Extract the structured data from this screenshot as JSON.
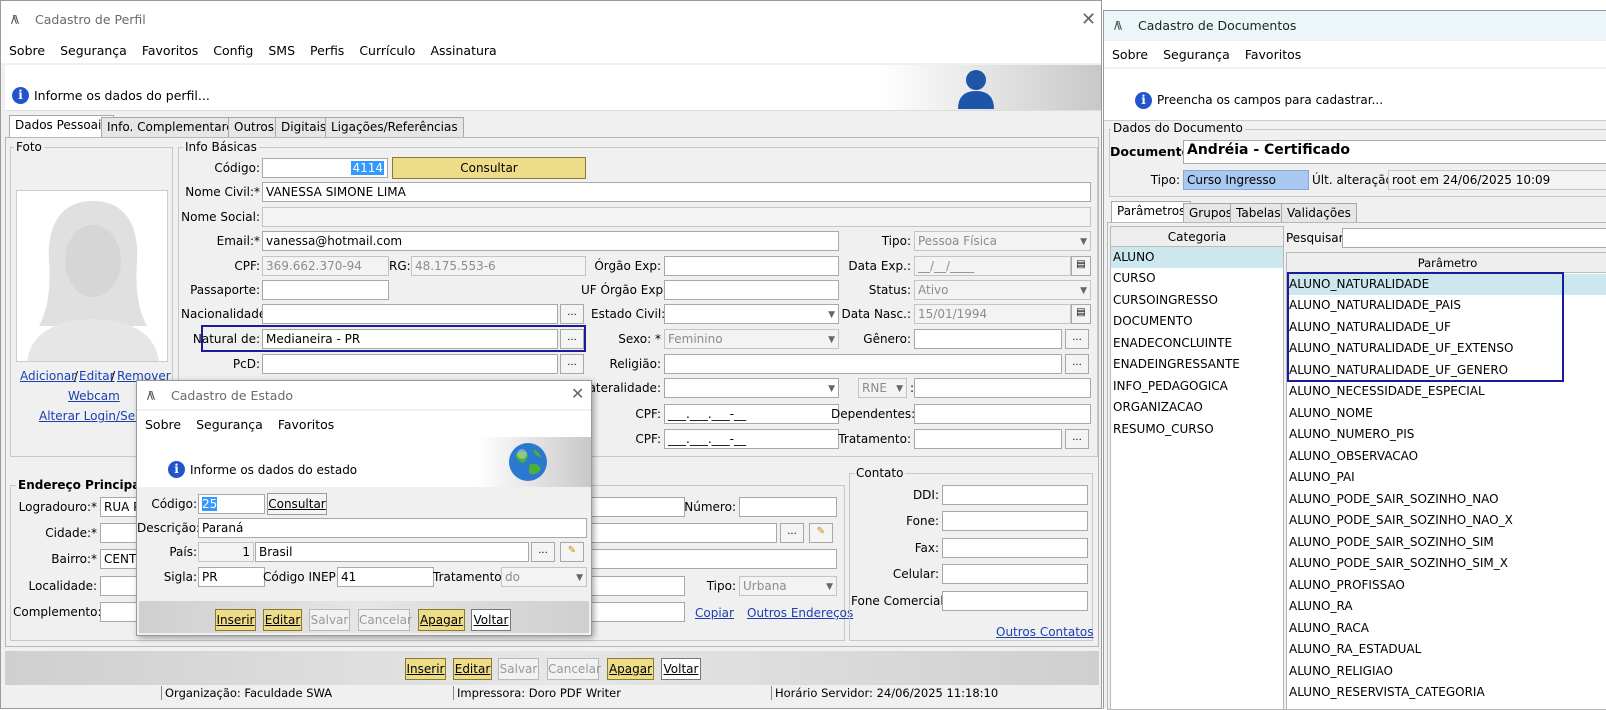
{
  "perfil": {
    "title": "Cadastro de Perfil",
    "menu": [
      "Sobre",
      "Segurança",
      "Favoritos",
      "Config",
      "SMS",
      "Perfis",
      "Currículo",
      "Assinatura"
    ],
    "info_msg": "Informe os dados do perfil...",
    "tabs": [
      "Dados Pessoais",
      "Info. Complementares",
      "Outros",
      "Digitais",
      "Ligações/Referências"
    ],
    "foto": {
      "title": "Foto",
      "adicionar": "Adicionar",
      "sep1": "/",
      "editar": "Editar",
      "sep2": "/",
      "remover": "Remover",
      "webcam": "Webcam",
      "alterar": "Alterar Login/Senha"
    },
    "info_basicas": {
      "title": "Info Básicas",
      "codigo_label": "Código:",
      "codigo": "4114",
      "consultar": "Consultar",
      "nome_civil_label": "Nome Civil:*",
      "nome_civil": "VANESSA SIMONE LIMA",
      "nome_social_label": "Nome Social:",
      "nome_social": "",
      "email_label": "Email:*",
      "email": "vanessa@hotmail.com",
      "tipo_label": "Tipo:",
      "tipo": "Pessoa Física",
      "cpf_label": "CPF:",
      "cpf": "369.662.370-94",
      "rg_label": "RG:",
      "rg": "48.175.553-6",
      "orgao_label": "Órgão Exp:",
      "orgao": "",
      "data_exp_label": "Data Exp.:",
      "data_exp": "__/__/____",
      "passaporte_label": "Passaporte:",
      "uf_orgao_label": "UF Órgão Exp:",
      "status_label": "Status:",
      "status": "Ativo",
      "nacionalidade_label": "Nacionalidade:",
      "estado_civil_label": "Estado Civil:",
      "data_nasc_label": "Data Nasc.:",
      "data_nasc": "15/01/1994",
      "natural_label": "Natural de:",
      "natural": "Medianeira - PR",
      "sexo_label": "Sexo: *",
      "sexo": "Feminino",
      "genero_label": "Gênero:",
      "pcd_label": "PcD:",
      "religiao_label": "Religião:",
      "lateralidade_label": "Lateralidade:",
      "rne": "RNE",
      "cpf2_label": "CPF:",
      "cpf2": "___.___.___-__",
      "dependentes_label": "Dependentes:",
      "cpf3_label": "CPF:",
      "cpf3": "___.___.___-__",
      "tratamento_label": "Tratamento:",
      "ellipsis": "..."
    },
    "endereco": {
      "title": "Endereço Principal",
      "logradouro_label": "Logradouro:*",
      "logradouro": "RUA PA",
      "numero_label": "Número:",
      "cidade_label": "Cidade:*",
      "bairro_label": "Bairro:*",
      "bairro": "CENTR",
      "localidade_label": "Localidade:",
      "tipo_label": "Tipo:",
      "tipo": "Urbana",
      "complemento_label": "Complemento:",
      "copiar": "Copiar",
      "outros": "Outros Endereços"
    },
    "contato": {
      "title": "Contato",
      "ddi": "DDI:",
      "fone": "Fone:",
      "fax": "Fax:",
      "celular": "Celular:",
      "fone_com": "Fone Comercial:",
      "outros": "Outros Contatos"
    },
    "buttons": {
      "inserir": "Inserir",
      "editar": "Editar",
      "salvar": "Salvar",
      "cancelar": "Cancelar",
      "apagar": "Apagar",
      "voltar": "Voltar"
    },
    "status_bar": {
      "org": "Organização: Faculdade SWA",
      "printer": "Impressora: Doro PDF Writer",
      "hora": "Horário Servidor: 24/06/2025 11:18:10"
    }
  },
  "estado": {
    "title": "Cadastro de Estado",
    "menu": [
      "Sobre",
      "Segurança",
      "Favoritos"
    ],
    "info_msg": "Informe os dados do estado",
    "codigo_label": "Código:",
    "codigo": "25",
    "consultar": "Consultar",
    "descricao_label": "Descrição:",
    "descricao": "Paraná",
    "pais_label": "País:",
    "pais_cod": "1",
    "pais": "Brasil",
    "sigla_label": "Sigla:",
    "sigla": "PR",
    "inep_label": "Código INEP:",
    "inep": "41",
    "tratamento_label": "Tratamento:",
    "tratamento": "do",
    "buttons": {
      "inserir": "Inserir",
      "editar": "Editar",
      "salvar": "Salvar",
      "cancelar": "Cancelar",
      "apagar": "Apagar",
      "voltar": "Voltar"
    }
  },
  "documentos": {
    "title": "Cadastro de Documentos",
    "menu": [
      "Sobre",
      "Segurança",
      "Favoritos"
    ],
    "info_msg": "Preencha os campos para cadastrar...",
    "group_title": "Dados do Documento",
    "documento_label": "Documento:",
    "documento": "Andréia - Certificado",
    "tipo_label": "Tipo:",
    "tipo": "Curso Ingresso",
    "ult_label": "Últ. alteração:",
    "ult": "root em 24/06/2025 10:09",
    "tabs": [
      "Parâmetros",
      "Grupos",
      "Tabelas",
      "Validações"
    ],
    "categoria_header": "Categoria",
    "categorias": [
      "ALUNO",
      "CURSO",
      "CURSOINGRESSO",
      "DOCUMENTO",
      "ENADECONCLUINTE",
      "ENADEINGRESSANTE",
      "INFO_PEDAGOGICA",
      "ORGANIZACAO",
      "RESUMO_CURSO"
    ],
    "pesquisar_label": "Pesquisar:",
    "parametro_header": "Parâmetro",
    "parametros": [
      "ALUNO_NATURALIDADE",
      "ALUNO_NATURALIDADE_PAIS",
      "ALUNO_NATURALIDADE_UF",
      "ALUNO_NATURALIDADE_UF_EXTENSO",
      "ALUNO_NATURALIDADE_UF_GENERO",
      "ALUNO_NECESSIDADE_ESPECIAL",
      "ALUNO_NOME",
      "ALUNO_NUMERO_PIS",
      "ALUNO_OBSERVACAO",
      "ALUNO_PAI",
      "ALUNO_PODE_SAIR_SOZINHO_NAO",
      "ALUNO_PODE_SAIR_SOZINHO_NAO_X",
      "ALUNO_PODE_SAIR_SOZINHO_SIM",
      "ALUNO_PODE_SAIR_SOZINHO_SIM_X",
      "ALUNO_PROFISSAO",
      "ALUNO_RA",
      "ALUNO_RACA",
      "ALUNO_RA_ESTADUAL",
      "ALUNO_RELIGIAO",
      "ALUNO_RESERVISTA_CATEGORIA"
    ]
  },
  "colors": {
    "highlight_border": "#1a1a9a",
    "button_yellow": "#eedd88",
    "selection": "#3399ff",
    "list_selected": "#cce8ee"
  }
}
